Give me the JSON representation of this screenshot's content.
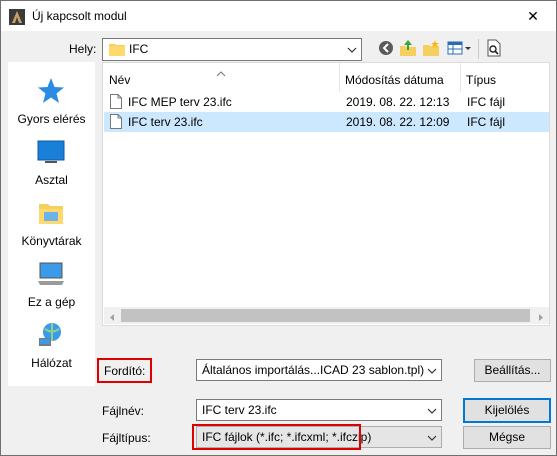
{
  "window": {
    "title": "Új kapcsolt modul",
    "close_label": "✕"
  },
  "toolbar": {
    "look_in_label": "Hely:",
    "look_in_value": "IFC"
  },
  "places": [
    {
      "label": "Gyors elérés",
      "icon": "star-icon"
    },
    {
      "label": "Asztal",
      "icon": "desktop-icon"
    },
    {
      "label": "Könyvtárak",
      "icon": "libraries-icon"
    },
    {
      "label": "Ez a gép",
      "icon": "computer-icon"
    },
    {
      "label": "Hálózat",
      "icon": "network-icon"
    }
  ],
  "filelist": {
    "columns": [
      "Név",
      "Módosítás dátuma",
      "Típus"
    ],
    "rows": [
      {
        "name": "IFC MEP terv 23.ifc",
        "date": "2019. 08. 22. 12:13",
        "type": "IFC fájl",
        "selected": false
      },
      {
        "name": "IFC terv 23.ifc",
        "date": "2019. 08. 22. 12:09",
        "type": "IFC fájl",
        "selected": true
      }
    ]
  },
  "translator": {
    "label": "Fordító:",
    "value": "Általános importálás...ICAD 23 sablon.tpl)",
    "settings_button": "Beállítás..."
  },
  "filename": {
    "label": "Fájlnév:",
    "value": "IFC terv 23.ifc"
  },
  "filetype": {
    "label": "Fájltípus:",
    "value": "IFC fájlok (*.ifc; *.ifcxml; *.ifczip)"
  },
  "buttons": {
    "open": "Kijelölés",
    "cancel": "Mégse"
  },
  "colors": {
    "highlight_box": "#e00000",
    "selection": "#cce8ff",
    "default_button_border": "#0078d7"
  }
}
